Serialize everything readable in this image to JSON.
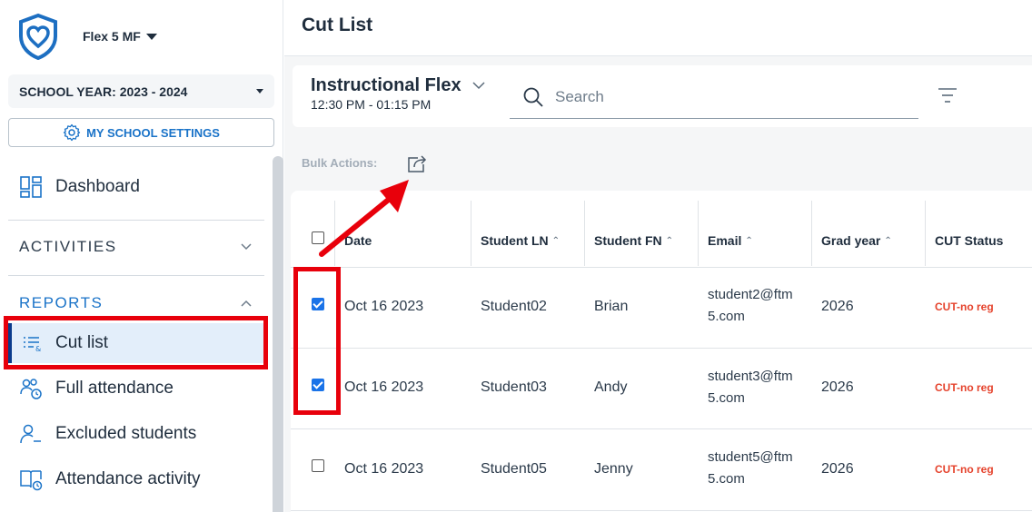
{
  "sidebar": {
    "school_name": "Flex 5 MF",
    "school_year": "SCHOOL YEAR: 2023 - 2024",
    "settings_label": "MY SCHOOL SETTINGS",
    "dashboard_label": "Dashboard",
    "activities_label": "ACTIVITIES",
    "reports_label": "REPORTS",
    "reports_items": [
      {
        "label": "Cut list",
        "icon": "list-filter-icon",
        "active": true
      },
      {
        "label": "Full attendance",
        "icon": "users-clock-icon"
      },
      {
        "label": "Excluded students",
        "icon": "user-minus-icon"
      },
      {
        "label": "Attendance activity",
        "icon": "book-clock-icon"
      }
    ],
    "accent_color": "#1a73c8",
    "active_bg": "#e3eefa"
  },
  "main": {
    "title": "Cut List",
    "period_name": "Instructional Flex",
    "period_time": "12:30 PM - 01:15 PM",
    "search_placeholder": "Search",
    "bulk_actions_label": "Bulk Actions:"
  },
  "table": {
    "columns": [
      "Date",
      "Student LN",
      "Student FN",
      "Email",
      "Grad year",
      "CUT Status"
    ],
    "rows": [
      {
        "checked": true,
        "date": "Oct 16 2023",
        "ln": "Student02",
        "fn": "Brian",
        "email1": "student2@ftm",
        "email2": "5.com",
        "grad": "2026",
        "status": "CUT-no reg"
      },
      {
        "checked": true,
        "date": "Oct 16 2023",
        "ln": "Student03",
        "fn": "Andy",
        "email1": "student3@ftm",
        "email2": "5.com",
        "grad": "2026",
        "status": "CUT-no reg"
      },
      {
        "checked": false,
        "date": "Oct 16 2023",
        "ln": "Student05",
        "fn": "Jenny",
        "email1": "student5@ftm",
        "email2": "5.com",
        "grad": "2026",
        "status": "CUT-no reg"
      }
    ],
    "status_color": "#e5432d"
  },
  "annotation_color": "#e8000b"
}
